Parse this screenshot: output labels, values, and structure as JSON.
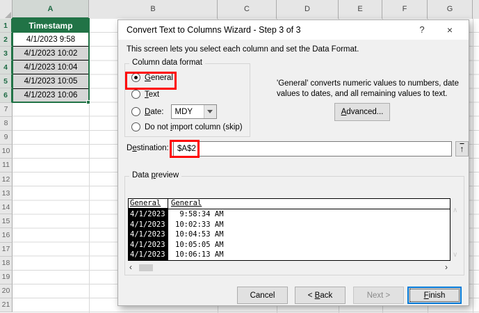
{
  "colors": {
    "accent_green": "#217346",
    "annotation_red": "#FF0000",
    "finish_focus_blue": "#0078D7"
  },
  "sheet": {
    "col_headers": [
      "A",
      "B",
      "C",
      "D",
      "E",
      "F",
      "G"
    ],
    "row_numbers": [
      "1",
      "2",
      "3",
      "4",
      "5",
      "6",
      "7",
      "8",
      "9",
      "10",
      "11",
      "12",
      "13",
      "14",
      "15",
      "16",
      "17",
      "18",
      "19",
      "20",
      "21"
    ],
    "a1_header": "Timestamp",
    "a_values": [
      "4/1/2023 9:58",
      "4/1/2023 10:02",
      "4/1/2023 10:04",
      "4/1/2023 10:05",
      "4/1/2023 10:06"
    ]
  },
  "dialog": {
    "title": "Convert Text to Columns Wizard - Step 3 of 3",
    "icons": {
      "help": "?",
      "close": "×",
      "collapse": "↑",
      "scroll_left": "‹",
      "scroll_right": "›",
      "scroll_up": "∧",
      "scroll_down": "∨"
    },
    "instruction": "This screen lets you select each column and set the Data Format.",
    "format_group": {
      "legend": "Column data format",
      "general": {
        "pre": "",
        "key": "G",
        "post": "eneral"
      },
      "text": {
        "pre": "",
        "key": "T",
        "post": "ext"
      },
      "date": {
        "pre": "",
        "key": "D",
        "post": "ate:"
      },
      "date_format_value": "MDY",
      "skip": {
        "pre": "Do not ",
        "key": "i",
        "post": "mport column (skip)"
      }
    },
    "general_note": "'General' converts numeric values to numbers, date values to dates, and all remaining values to text.",
    "advanced_button": {
      "pre": "",
      "key": "A",
      "post": "dvanced..."
    },
    "destination": {
      "label": {
        "pre": "D",
        "key": "e",
        "post": "stination:"
      },
      "value": "$A$2"
    },
    "preview": {
      "legend": {
        "pre": "Data ",
        "key": "p",
        "post": "review"
      },
      "col1_header": "General",
      "col2_header": "General",
      "rows": [
        {
          "date": "4/1/2023",
          "time": " 9:58:34 AM"
        },
        {
          "date": "4/1/2023",
          "time": "10:02:33 AM"
        },
        {
          "date": "4/1/2023",
          "time": "10:04:53 AM"
        },
        {
          "date": "4/1/2023",
          "time": "10:05:05 AM"
        },
        {
          "date": "4/1/2023",
          "time": "10:06:13 AM"
        }
      ]
    },
    "buttons": {
      "cancel": "Cancel",
      "back": {
        "pre": "< ",
        "key": "B",
        "post": "ack"
      },
      "next": "Next >",
      "finish": {
        "pre": "",
        "key": "F",
        "post": "inish"
      }
    }
  }
}
